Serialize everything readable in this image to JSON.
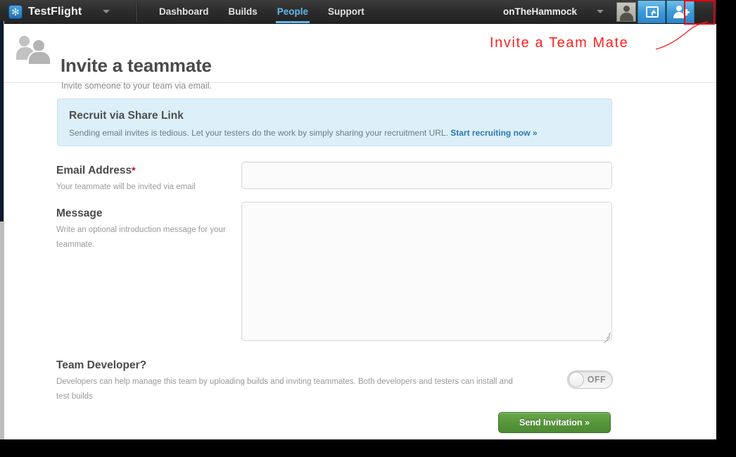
{
  "topbar": {
    "brand": "TestFlight",
    "brand_icon": "snowflake-logo-icon",
    "brand_caret_icon": "chevron-down-icon",
    "nav": [
      {
        "label": "Dashboard",
        "active": false
      },
      {
        "label": "Builds",
        "active": false
      },
      {
        "label": "People",
        "active": true
      },
      {
        "label": "Support",
        "active": false
      }
    ],
    "team": "onTheHammock",
    "team_caret_icon": "chevron-down-icon",
    "avatar_icon": "user-avatar",
    "upload_icon": "upload-box-icon",
    "adduser_icon": "add-person-icon"
  },
  "page": {
    "icon": "two-people-icon",
    "title": "Invite a teammate",
    "subtitle": "Invite someone to your team via email."
  },
  "annotation": {
    "text": "Invite a Team Mate",
    "color": "#ff1f1f",
    "pointer_icon": "callout-line"
  },
  "share_box": {
    "title": "Recruit via Share Link",
    "description": "Sending email invites is tedious. Let your testers do the work by simply sharing your recruitment URL.",
    "link": "Start recruiting now »",
    "bg_color": "#ddeff9",
    "link_color": "#2a7ab0"
  },
  "form": {
    "email": {
      "label": "Email Address",
      "required_marker": "*",
      "help": "Your teammate will be invited via email",
      "value": "",
      "placeholder": ""
    },
    "message": {
      "label": "Message",
      "help": "Write an optional introduction message for your teammate.",
      "value": "",
      "placeholder": ""
    },
    "developer": {
      "label": "Team Developer?",
      "help": "Developers can help manage this team by uploading builds and inviting teammates. Both developers and testers can install and test builds",
      "toggle_state": "OFF"
    },
    "submit": {
      "label": "Send Invitation »",
      "color": "#57963b"
    }
  },
  "scrollbar": {
    "orientation": "vertical",
    "thumb_color": "#0d1b2e"
  }
}
